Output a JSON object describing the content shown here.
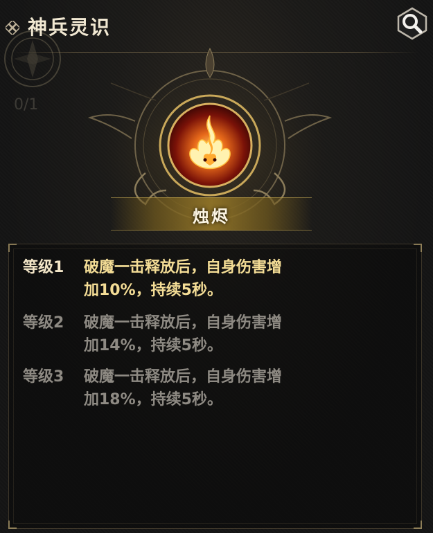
{
  "header": {
    "title": "神兵灵识",
    "title_icon": "knot-icon",
    "search_icon": "magnifier-icon"
  },
  "background": {
    "faded_count": "0/1"
  },
  "skill": {
    "name": "烛烬",
    "icon": "flame-icon",
    "accent_color": "#e8a030"
  },
  "levels": [
    {
      "label": "等级1",
      "line1": "破魔一击释放后，自身伤害增",
      "line2": "加10%，持续5秒。",
      "state": "active"
    },
    {
      "label": "等级2",
      "line1": "破魔一击释放后，自身伤害增",
      "line2": "加14%，持续5秒。",
      "state": "inactive"
    },
    {
      "label": "等级3",
      "line1": "破魔一击释放后，自身伤害增",
      "line2": "加18%，持续5秒。",
      "state": "inactive"
    }
  ],
  "colors": {
    "active_label": "#f3e6c8",
    "active_text": "#f4dd96",
    "inactive_text": "#8e8a83",
    "title": "#f1e8d2"
  }
}
